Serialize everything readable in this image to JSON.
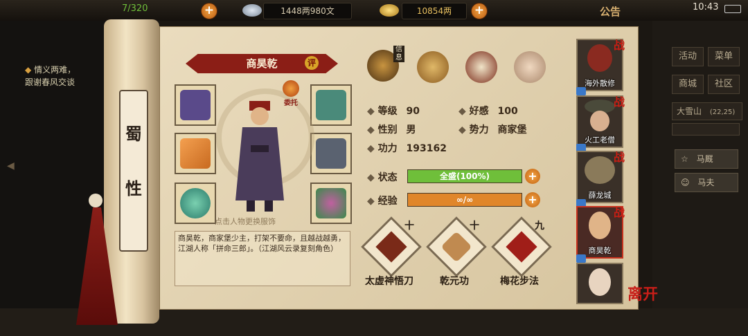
{
  "status_bar": {
    "partial_value": "7/320",
    "money": "1448两980文",
    "ingot": "10854两",
    "notice": "公告",
    "time": "10:43"
  },
  "quest": {
    "title": "情义两难，",
    "detail": "跟谢春风交谈"
  },
  "right_menu": {
    "buttons": [
      "活动",
      "菜单",
      "商城",
      "社区"
    ],
    "location": "大雪山",
    "coords": "(22,25)",
    "items": [
      "马厩",
      "马夫"
    ]
  },
  "scroll_title": [
    "蜀",
    "性"
  ],
  "character": {
    "name": "商昊乾",
    "rate_label": "评",
    "weituo_label": "委托",
    "change_hint": "点击人物更换服饰",
    "description": "商昊乾，商家堡少主，打架不要命，且越战越勇，江湖人称「拼命三郎」。（江湖风云录复刻角色）"
  },
  "tabs": {
    "info_label": "信息"
  },
  "stats": {
    "level_label": "等级",
    "level_value": "90",
    "favor_label": "好感",
    "favor_value": "100",
    "gender_label": "性别",
    "gender_value": "男",
    "faction_label": "势力",
    "faction_value": "商家堡",
    "power_label": "功力",
    "power_value": "193162",
    "state_label": "状态",
    "state_value": "全盛(100%)",
    "state_fraction": 1.0,
    "exp_label": "经验",
    "exp_value": "∞/∞",
    "exp_fraction": 1.0
  },
  "skills": [
    {
      "name": "太虚神悟刀",
      "mark": "十"
    },
    {
      "name": "乾元功",
      "mark": "十"
    },
    {
      "name": "梅花步法",
      "mark": "九"
    }
  ],
  "party": [
    "海外散修",
    "火工老僧",
    "薛龙城",
    "商昊乾",
    ""
  ],
  "party_badge": "战",
  "leave_label": "离开",
  "colors": {
    "accent_red": "#8b1e16",
    "state_bar": "#6fbf3a",
    "exp_bar": "#e0862a"
  }
}
